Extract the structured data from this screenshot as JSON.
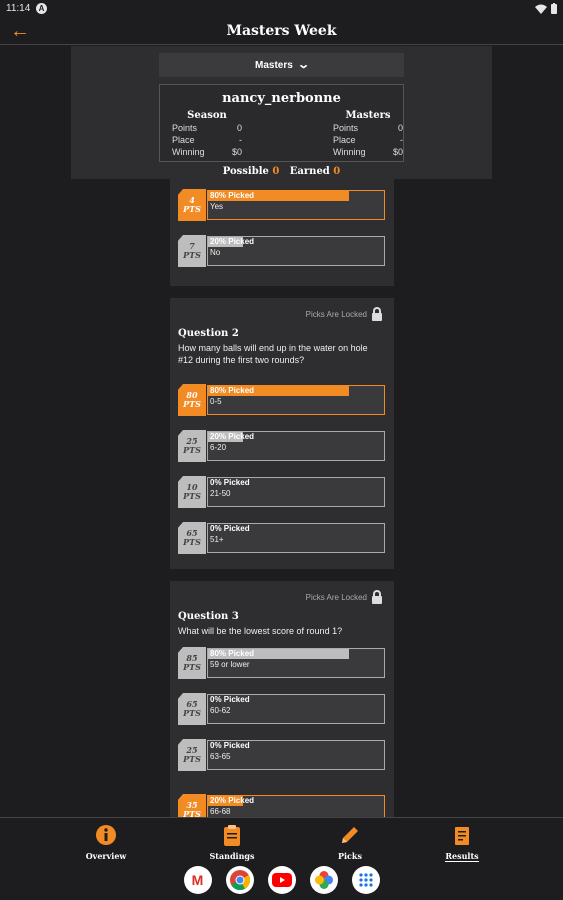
{
  "status_bar": {
    "time": "11:14",
    "notif_glyph": "A"
  },
  "app_bar": {
    "title": "Masters Week",
    "back_icon": "back-arrow-icon"
  },
  "header": {
    "dropdown_label": "Masters",
    "username": "nancy_nerbonne",
    "season": {
      "heading": "Season",
      "rows": [
        {
          "label": "Points",
          "value": "0"
        },
        {
          "label": "Place",
          "value": "-"
        },
        {
          "label": "Winning",
          "value": "$0"
        }
      ]
    },
    "masters": {
      "heading": "Masters",
      "rows": [
        {
          "label": "Points",
          "value": "0"
        },
        {
          "label": "Place",
          "value": "-"
        },
        {
          "label": "Winning",
          "value": "$0"
        }
      ]
    },
    "possible_label": "Possible",
    "possible_value": "0",
    "earned_label": "Earned",
    "earned_value": "0"
  },
  "locked_label": "Picks Are Locked",
  "pts_label": "PTS",
  "questions": [
    {
      "title": "",
      "text": "",
      "options": [
        {
          "pts": "4",
          "pct_label": "80% Picked",
          "pct": 80,
          "answer": "Yes",
          "selected": true
        },
        {
          "pts": "7",
          "pct_label": "20% Picked",
          "pct": 20,
          "answer": "No",
          "selected": false
        }
      ]
    },
    {
      "title": "Question 2",
      "text": "How many balls will end up in the water on hole #12 during the first two rounds?",
      "options": [
        {
          "pts": "80",
          "pct_label": "80% Picked",
          "pct": 80,
          "answer": "0-5",
          "selected": true
        },
        {
          "pts": "25",
          "pct_label": "20% Picked",
          "pct": 20,
          "answer": "6-20",
          "selected": false
        },
        {
          "pts": "10",
          "pct_label": "0% Picked",
          "pct": 0,
          "answer": "21-50",
          "selected": false
        },
        {
          "pts": "65",
          "pct_label": "0% Picked",
          "pct": 0,
          "answer": "51+",
          "selected": false
        }
      ]
    },
    {
      "title": "Question 3",
      "text": "What will be the lowest score of round 1?",
      "options": [
        {
          "pts": "85",
          "pct_label": "80% Picked",
          "pct": 80,
          "answer": "59 or lower",
          "selected": false
        },
        {
          "pts": "65",
          "pct_label": "0% Picked",
          "pct": 0,
          "answer": "60-62",
          "selected": false
        },
        {
          "pts": "25",
          "pct_label": "0% Picked",
          "pct": 0,
          "answer": "63-65",
          "selected": false
        },
        {
          "pts": "35",
          "pct_label": "20% Picked",
          "pct": 20,
          "answer": "66-68",
          "selected": true
        }
      ]
    }
  ],
  "bottom_nav": [
    {
      "label": "Overview",
      "icon": "info-icon",
      "active": false
    },
    {
      "label": "Standings",
      "icon": "clipboard-icon",
      "active": false
    },
    {
      "label": "Picks",
      "icon": "pencil-icon",
      "active": false
    },
    {
      "label": "Results",
      "icon": "results-icon",
      "active": true
    }
  ],
  "dock_apps": [
    {
      "icon": "gmail-icon",
      "glyph": "M",
      "color": "#d93025"
    },
    {
      "icon": "chrome-icon",
      "glyph": "",
      "color": "#1a73e8"
    },
    {
      "icon": "youtube-icon",
      "glyph": "",
      "color": "#ff0000"
    },
    {
      "icon": "photos-icon",
      "glyph": "",
      "color": "#34a853"
    },
    {
      "icon": "apps-grid-icon",
      "glyph": "⋮⋮",
      "color": "#1a73e8"
    }
  ],
  "colors": {
    "accent": "#f38b25",
    "background": "#1d1d1f",
    "card": "#2e2e30"
  }
}
